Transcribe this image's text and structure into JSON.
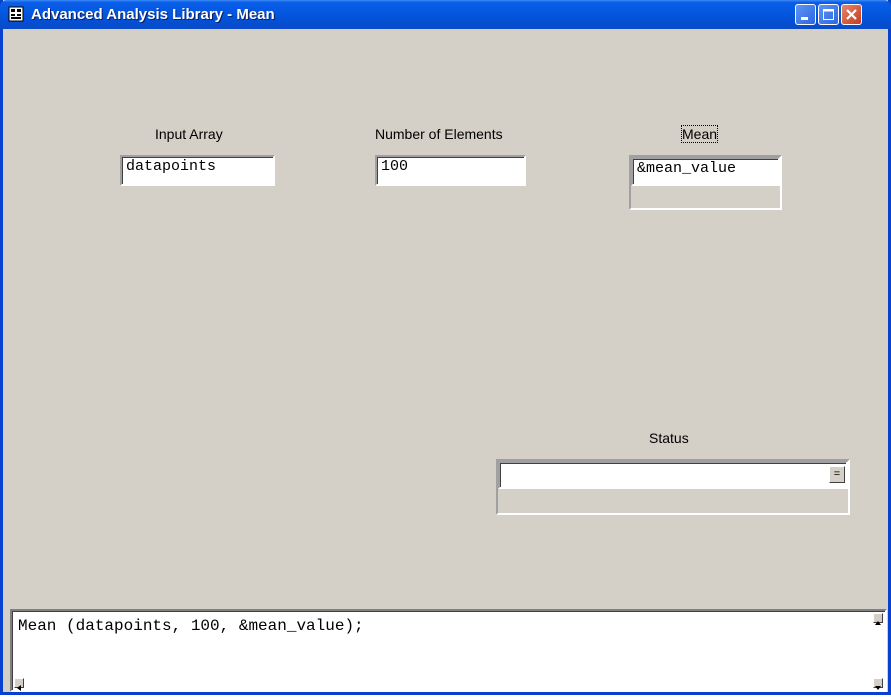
{
  "window": {
    "title": "Advanced Analysis Library - Mean",
    "icon": "panel-icon",
    "controls": [
      "minimize-icon",
      "maximize-icon",
      "close-icon"
    ]
  },
  "panel": {
    "input_array": {
      "label": "Input Array",
      "value": "datapoints"
    },
    "num_elements": {
      "label": "Number of Elements",
      "value": "100"
    },
    "mean": {
      "label": "Mean",
      "value": "&mean_value"
    },
    "status": {
      "label": "Status",
      "value": "",
      "ring_button_glyph": "="
    }
  },
  "code": {
    "line": "Mean (datapoints, 100, &mean_value);"
  },
  "colors": {
    "panel_bg": "#d4d0c8",
    "titlebar": "#0458e0",
    "close_button": "#c63b1c"
  }
}
